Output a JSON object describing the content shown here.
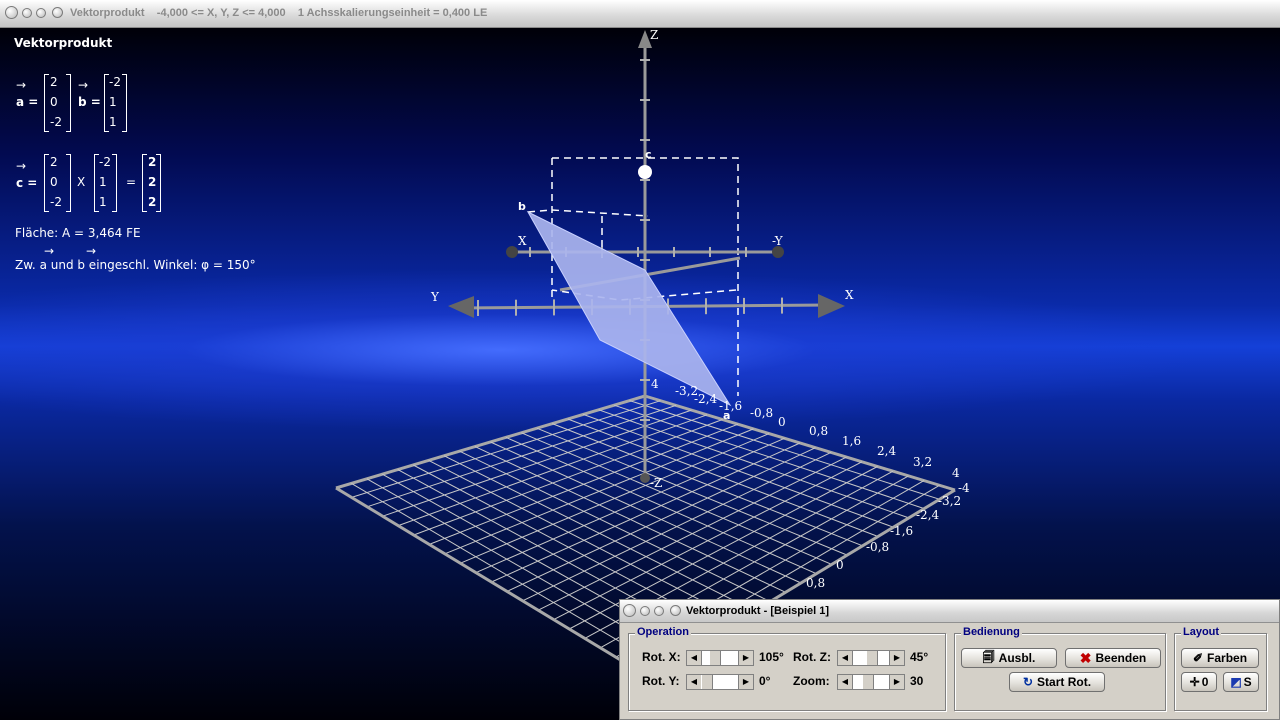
{
  "window": {
    "title": "Vektorprodukt    -4,000 <= X, Y, Z <= 4,000    1 Achsskalierungseinheit = 0,400 LE"
  },
  "info": {
    "heading": "Vektorprodukt",
    "vec_a_label": "a =",
    "vec_a": [
      "2",
      "0",
      "-2"
    ],
    "vec_b_label": "b =",
    "vec_b": [
      "-2",
      "1",
      "1"
    ],
    "vec_c_label": "c =",
    "cross_sign": "X",
    "equals_sign": "=",
    "vec_c": [
      "2",
      "2",
      "2"
    ],
    "area": "Fläche: A = 3,464 FE",
    "angle": "Zw. a und b eingeschl. Winkel: φ = 150°"
  },
  "scene": {
    "axis_labels": {
      "z_pos": "Z",
      "z_neg": "-Z",
      "x_pos": "X",
      "x_neg": "X",
      "y_pos": "Y",
      "y_neg": "-Y"
    },
    "point_labels": {
      "a": "a",
      "b": "b",
      "c": "c"
    },
    "grid_ticks_front": [
      "-3,2",
      "-2,4",
      "-1,6",
      "-0,8",
      "0",
      "0,8",
      "1,6",
      "2,4",
      "3,2",
      "4"
    ],
    "grid_ticks_right": [
      "-4",
      "-3,2",
      "-2,4",
      "-1,6",
      "-0,8",
      "0",
      "0,8"
    ],
    "z_tick": "4",
    "colors": {
      "parallelogram": "#aab4ee",
      "axis": "#8a8a8a"
    }
  },
  "panel": {
    "title": "Vektorprodukt - [Beispiel 1]",
    "operation": {
      "label": "Operation",
      "rot_x_label": "Rot. X:",
      "rot_x_value": "105°",
      "rot_z_label": "Rot. Z:",
      "rot_z_value": "45°",
      "rot_y_label": "Rot. Y:",
      "rot_y_value": "0°",
      "zoom_label": "Zoom:",
      "zoom_value": "30"
    },
    "bedienung": {
      "label": "Bedienung",
      "ausbl": "Ausbl.",
      "beenden": "Beenden",
      "start_rot": "Start Rot."
    },
    "layout": {
      "label": "Layout",
      "farben": "Farben",
      "zero": "0",
      "s": "S"
    }
  }
}
